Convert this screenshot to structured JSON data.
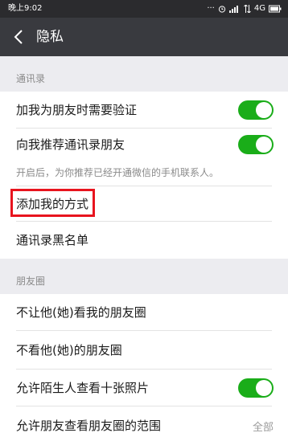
{
  "status_bar": {
    "time": "晚上9:02",
    "network": "4G"
  },
  "nav": {
    "title": "隐私"
  },
  "sections": {
    "contacts_header": "通讯录",
    "moments_header": "朋友圈"
  },
  "settings": {
    "verify_friend": {
      "label": "加我为朋友时需要验证",
      "enabled": true
    },
    "recommend_contacts": {
      "label": "向我推荐通讯录朋友",
      "enabled": true
    },
    "recommend_hint": "开启后，为你推荐已经开通微信的手机联系人。",
    "add_methods": {
      "label": "添加我的方式"
    },
    "contact_blacklist": {
      "label": "通讯录黑名单"
    },
    "hide_my_moments": {
      "label": "不让他(她)看我的朋友圈"
    },
    "hide_their_moments": {
      "label": "不看他(她)的朋友圈"
    },
    "stranger_ten_photos": {
      "label": "允许陌生人查看十张照片",
      "enabled": true
    },
    "moments_range": {
      "label": "允许朋友查看朋友圈的范围",
      "value": "全部"
    }
  },
  "colors": {
    "toggle_on": "#1aad19",
    "highlight": "#e8141e",
    "nav_bg": "#393a3f"
  }
}
